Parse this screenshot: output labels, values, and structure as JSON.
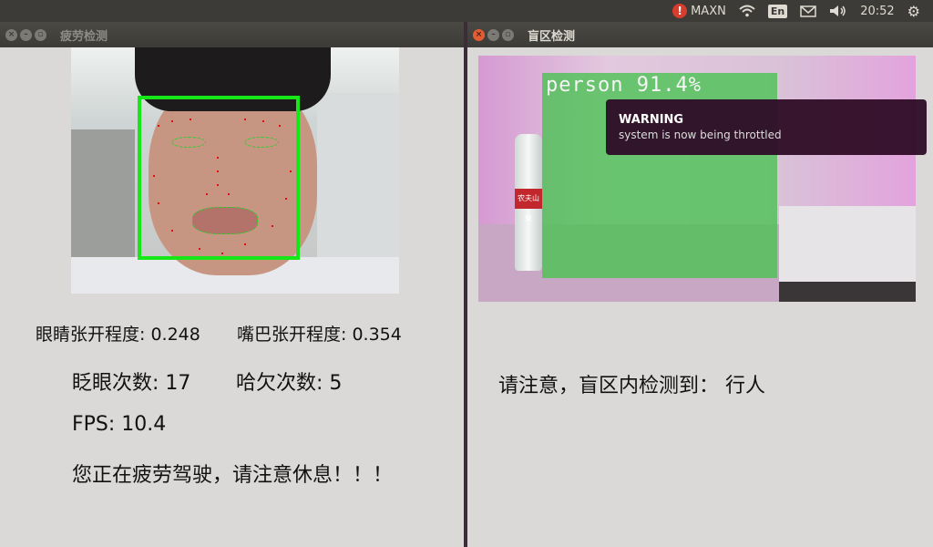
{
  "topbar": {
    "alert_glyph": "!",
    "power_mode": "MAXN",
    "input_lang": "En",
    "time": "20:52"
  },
  "left_window": {
    "title": "疲劳检测",
    "eye_open": "眼睛张开程度: 0.248",
    "mouth_open": "嘴巴张开程度: 0.354",
    "blinks": "眨眼次数: 17",
    "yawns": "哈欠次数: 5",
    "fps": "FPS: 10.4",
    "warning": "您正在疲劳驾驶，请注意休息！！！"
  },
  "right_window": {
    "title": "盲区检测",
    "detection_label": "person 91.4%",
    "bottle_text": "农夫山泉",
    "message": "请注意，盲区内检测到： 行人"
  },
  "notification": {
    "title": "WARNING",
    "body": "system is now being throttled"
  },
  "colors": {
    "detect_box": "#16e716",
    "person_box": "#46c350",
    "panel_bg": "#3c3b37",
    "window_bg": "#dad9d7"
  },
  "icons": [
    "alert-icon",
    "wifi-icon",
    "keyboard-lang-icon",
    "mail-icon",
    "volume-icon",
    "gear-icon",
    "close-icon",
    "minimize-icon",
    "maximize-icon"
  ]
}
